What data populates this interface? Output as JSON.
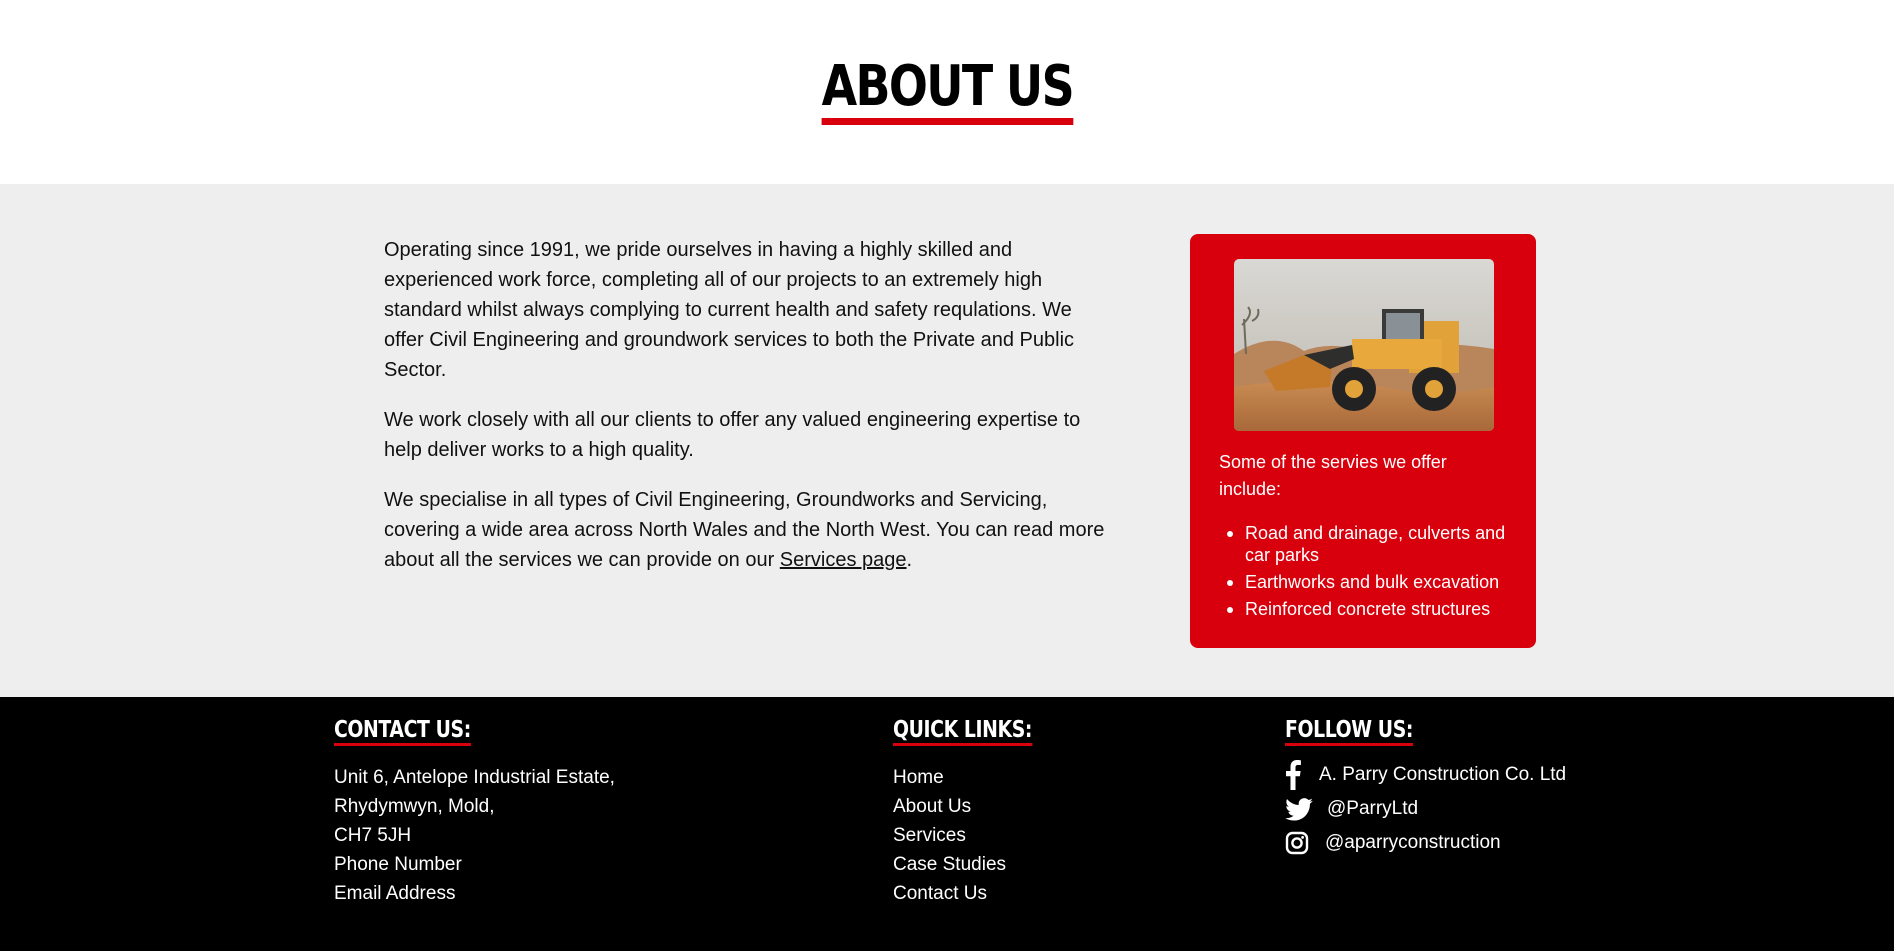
{
  "hero": {
    "title": "ABOUT US"
  },
  "about": {
    "paragraphs": [
      "Operating since 1991, we pride ourselves in having a highly skilled and experienced work force, completing all of our projects to an extremely high standard whilst always complying to current health and safety requlations. We offer Civil Engineering and groundwork services to both the Private and Public Sector.",
      "We work closely with all our clients to offer any valued engineering expertise to help deliver works to a high quality."
    ],
    "p3_before": "We specialise in all types of Civil Engineering, Groundworks and Servicing, covering a wide area across North Wales and the North West. You can read more about all the services we can provide on our ",
    "p3_link": "Services page",
    "p3_after": "."
  },
  "services_card": {
    "intro": "Some of the servies we offer include:",
    "items": [
      "Road and drainage, culverts and car parks",
      "Earthworks and bulk excavation",
      "Reinforced concrete structures"
    ],
    "accent_color": "#d8000c"
  },
  "footer": {
    "contact": {
      "heading": "CONTACT US:",
      "lines": [
        "Unit 6, Antelope Industrial Estate,",
        "Rhydymwyn, Mold,",
        "CH7 5JH",
        "Phone Number",
        "Email Address"
      ]
    },
    "quick_links": {
      "heading": "QUICK LINKS:",
      "links": [
        "Home",
        "About Us",
        "Services",
        "Case Studies",
        "Contact Us"
      ]
    },
    "follow": {
      "heading": "FOLLOW US:",
      "items": [
        {
          "icon": "facebook-icon",
          "label": "A. Parry Construction Co. Ltd"
        },
        {
          "icon": "twitter-icon",
          "label": "@ParryLtd"
        },
        {
          "icon": "instagram-icon",
          "label": "@aparryconstruction"
        }
      ]
    }
  }
}
